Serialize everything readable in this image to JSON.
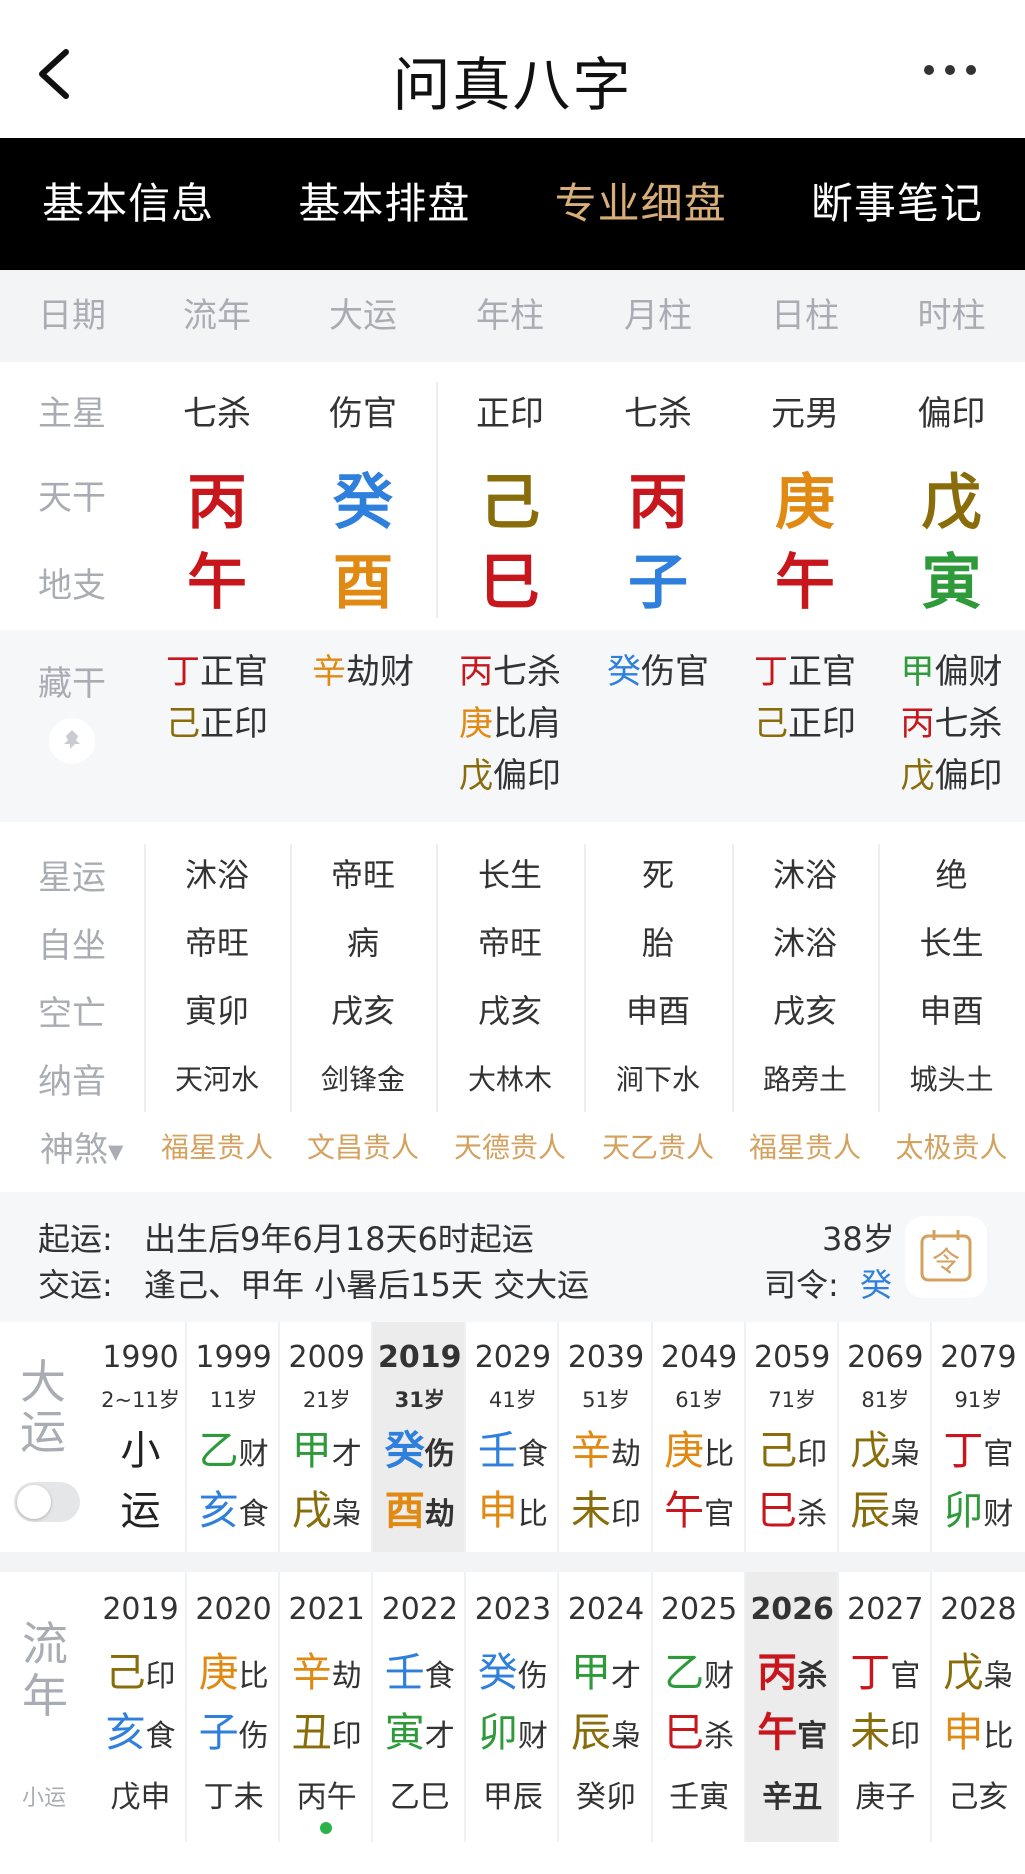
{
  "header": {
    "title": "问真八字"
  },
  "tabs": [
    "基本信息",
    "基本排盘",
    "专业细盘",
    "断事笔记"
  ],
  "columns": [
    "日期",
    "流年",
    "大运",
    "年柱",
    "月柱",
    "日柱",
    "时柱"
  ],
  "row_labels": {
    "main_star": "主星",
    "stem": "天干",
    "branch": "地支",
    "hidden": "藏干",
    "fate": "星运",
    "self_seat": "自坐",
    "void": "空亡",
    "nayin": "纳音",
    "shensha": "神煞"
  },
  "pillars": [
    {
      "main_star": "七杀",
      "stem": "丙",
      "stem_color": "#c8161d",
      "branch": "午",
      "branch_color": "#c8161d",
      "hidden": [
        {
          "g": "丁",
          "c": "#c8161d",
          "s": "正官"
        },
        {
          "g": "己",
          "c": "#8a6d0b",
          "s": "正印"
        }
      ],
      "fate": "沐浴",
      "self_seat": "帝旺",
      "void": "寅卯",
      "nayin": "天河水",
      "shensha": "福星贵人"
    },
    {
      "main_star": "伤官",
      "stem": "癸",
      "stem_color": "#2f7fdc",
      "branch": "酉",
      "branch_color": "#e08a14",
      "hidden": [
        {
          "g": "辛",
          "c": "#e08a14",
          "s": "劫财"
        }
      ],
      "fate": "帝旺",
      "self_seat": "病",
      "void": "戌亥",
      "nayin": "剑锋金",
      "shensha": "文昌贵人"
    },
    {
      "main_star": "正印",
      "stem": "己",
      "stem_color": "#8a6d0b",
      "branch": "巳",
      "branch_color": "#c8161d",
      "hidden": [
        {
          "g": "丙",
          "c": "#c8161d",
          "s": "七杀"
        },
        {
          "g": "庚",
          "c": "#e08a14",
          "s": "比肩"
        },
        {
          "g": "戊",
          "c": "#8a6d0b",
          "s": "偏印"
        }
      ],
      "fate": "长生",
      "self_seat": "帝旺",
      "void": "戌亥",
      "nayin": "大林木",
      "shensha": "天德贵人"
    },
    {
      "main_star": "七杀",
      "stem": "丙",
      "stem_color": "#c8161d",
      "branch": "子",
      "branch_color": "#2f7fdc",
      "hidden": [
        {
          "g": "癸",
          "c": "#2f7fdc",
          "s": "伤官"
        }
      ],
      "fate": "死",
      "self_seat": "胎",
      "void": "申酉",
      "nayin": "涧下水",
      "shensha": "天乙贵人"
    },
    {
      "main_star": "元男",
      "stem": "庚",
      "stem_color": "#e08a14",
      "branch": "午",
      "branch_color": "#c8161d",
      "hidden": [
        {
          "g": "丁",
          "c": "#c8161d",
          "s": "正官"
        },
        {
          "g": "己",
          "c": "#8a6d0b",
          "s": "正印"
        }
      ],
      "fate": "沐浴",
      "self_seat": "沐浴",
      "void": "戌亥",
      "nayin": "路旁土",
      "shensha": "福星贵人"
    },
    {
      "main_star": "偏印",
      "stem": "戊",
      "stem_color": "#8a6d0b",
      "branch": "寅",
      "branch_color": "#2e9a3a",
      "hidden": [
        {
          "g": "甲",
          "c": "#2e9a3a",
          "s": "偏财"
        },
        {
          "g": "丙",
          "c": "#c8161d",
          "s": "七杀"
        },
        {
          "g": "戊",
          "c": "#8a6d0b",
          "s": "偏印"
        }
      ],
      "fate": "绝",
      "self_seat": "长生",
      "void": "申酉",
      "nayin": "城头土",
      "shensha": "太极贵人"
    }
  ],
  "qiyun": {
    "label1": "起运:",
    "text1": "出生后9年6月18天6时起运",
    "label2": "交运:",
    "text2": "逢己、甲年 小暑后15天 交大运",
    "age": "38岁",
    "siling_label": "司令:",
    "siling_value": "癸",
    "cal_glyph": "令"
  },
  "dayun": {
    "label_top": "大",
    "label_bottom": "运",
    "items": [
      {
        "year": "1990",
        "age": "2~11岁",
        "g": "小",
        "gc": "#222",
        "gs": "",
        "b": "运",
        "bc": "#222",
        "bs": ""
      },
      {
        "year": "1999",
        "age": "11岁",
        "g": "乙",
        "gc": "#2e9a3a",
        "gs": "财",
        "b": "亥",
        "bc": "#2f7fdc",
        "bs": "食"
      },
      {
        "year": "2009",
        "age": "21岁",
        "g": "甲",
        "gc": "#2e9a3a",
        "gs": "才",
        "b": "戌",
        "bc": "#8a6d0b",
        "bs": "枭"
      },
      {
        "year": "2019",
        "age": "31岁",
        "g": "癸",
        "gc": "#2f7fdc",
        "gs": "伤",
        "b": "酉",
        "bc": "#e08a14",
        "bs": "劫",
        "current": true
      },
      {
        "year": "2029",
        "age": "41岁",
        "g": "壬",
        "gc": "#2f7fdc",
        "gs": "食",
        "b": "申",
        "bc": "#e08a14",
        "bs": "比"
      },
      {
        "year": "2039",
        "age": "51岁",
        "g": "辛",
        "gc": "#e08a14",
        "gs": "劫",
        "b": "未",
        "bc": "#8a6d0b",
        "bs": "印"
      },
      {
        "year": "2049",
        "age": "61岁",
        "g": "庚",
        "gc": "#e08a14",
        "gs": "比",
        "b": "午",
        "bc": "#c8161d",
        "bs": "官"
      },
      {
        "year": "2059",
        "age": "71岁",
        "g": "己",
        "gc": "#8a6d0b",
        "gs": "印",
        "b": "巳",
        "bc": "#c8161d",
        "bs": "杀"
      },
      {
        "year": "2069",
        "age": "81岁",
        "g": "戊",
        "gc": "#8a6d0b",
        "gs": "枭",
        "b": "辰",
        "bc": "#8a6d0b",
        "bs": "枭"
      },
      {
        "year": "2079",
        "age": "91岁",
        "g": "丁",
        "gc": "#c8161d",
        "gs": "官",
        "b": "卯",
        "bc": "#2e9a3a",
        "bs": "财"
      }
    ]
  },
  "liunian": {
    "label_top": "流",
    "label_bottom": "年",
    "label_small": "小运",
    "items": [
      {
        "year": "2019",
        "g": "己",
        "gc": "#8a6d0b",
        "gs": "印",
        "b": "亥",
        "bc": "#2f7fdc",
        "bs": "食",
        "xy": "戊申"
      },
      {
        "year": "2020",
        "g": "庚",
        "gc": "#e08a14",
        "gs": "比",
        "b": "子",
        "bc": "#2f7fdc",
        "bs": "伤",
        "xy": "丁未"
      },
      {
        "year": "2021",
        "g": "辛",
        "gc": "#e08a14",
        "gs": "劫",
        "b": "丑",
        "bc": "#8a6d0b",
        "bs": "印",
        "xy": "丙午",
        "dot": true
      },
      {
        "year": "2022",
        "g": "壬",
        "gc": "#2f7fdc",
        "gs": "食",
        "b": "寅",
        "bc": "#2e9a3a",
        "bs": "才",
        "xy": "乙巳"
      },
      {
        "year": "2023",
        "g": "癸",
        "gc": "#2f7fdc",
        "gs": "伤",
        "b": "卯",
        "bc": "#2e9a3a",
        "bs": "财",
        "xy": "甲辰"
      },
      {
        "year": "2024",
        "g": "甲",
        "gc": "#2e9a3a",
        "gs": "才",
        "b": "辰",
        "bc": "#8a6d0b",
        "bs": "枭",
        "xy": "癸卯"
      },
      {
        "year": "2025",
        "g": "乙",
        "gc": "#2e9a3a",
        "gs": "财",
        "b": "巳",
        "bc": "#c8161d",
        "bs": "杀",
        "xy": "壬寅"
      },
      {
        "year": "2026",
        "g": "丙",
        "gc": "#c8161d",
        "gs": "杀",
        "b": "午",
        "bc": "#c8161d",
        "bs": "官",
        "xy": "辛丑",
        "current": true
      },
      {
        "year": "2027",
        "g": "丁",
        "gc": "#c8161d",
        "gs": "官",
        "b": "未",
        "bc": "#8a6d0b",
        "bs": "印",
        "xy": "庚子"
      },
      {
        "year": "2028",
        "g": "戊",
        "gc": "#8a6d0b",
        "gs": "枭",
        "b": "申",
        "bc": "#e08a14",
        "bs": "比",
        "xy": "己亥"
      }
    ]
  }
}
